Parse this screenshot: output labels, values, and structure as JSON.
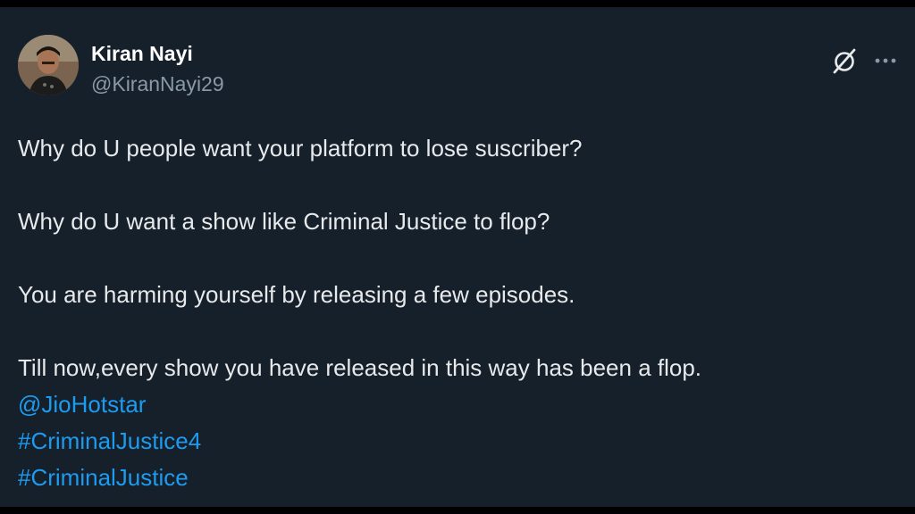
{
  "user": {
    "name": "Kiran Nayi",
    "handle": "@KiranNayi29"
  },
  "actions": {
    "grok_icon": "grok-icon",
    "more_icon": "more-icon"
  },
  "tweet": {
    "paragraphs": [
      "Why do U people want your platform to lose suscriber?",
      "Why do U want a show like Criminal Justice to flop?",
      "You are harming yourself by releasing a few episodes.",
      "Till now,every show you have released in this way has been a flop."
    ],
    "mention": "@JioHotstar",
    "hashtags": [
      "#CriminalJustice4",
      "#CriminalJustice"
    ]
  },
  "colors": {
    "background": "#15202b",
    "text": "#e7e9ea",
    "secondary": "#8b98a5",
    "link": "#1d9bf0"
  }
}
